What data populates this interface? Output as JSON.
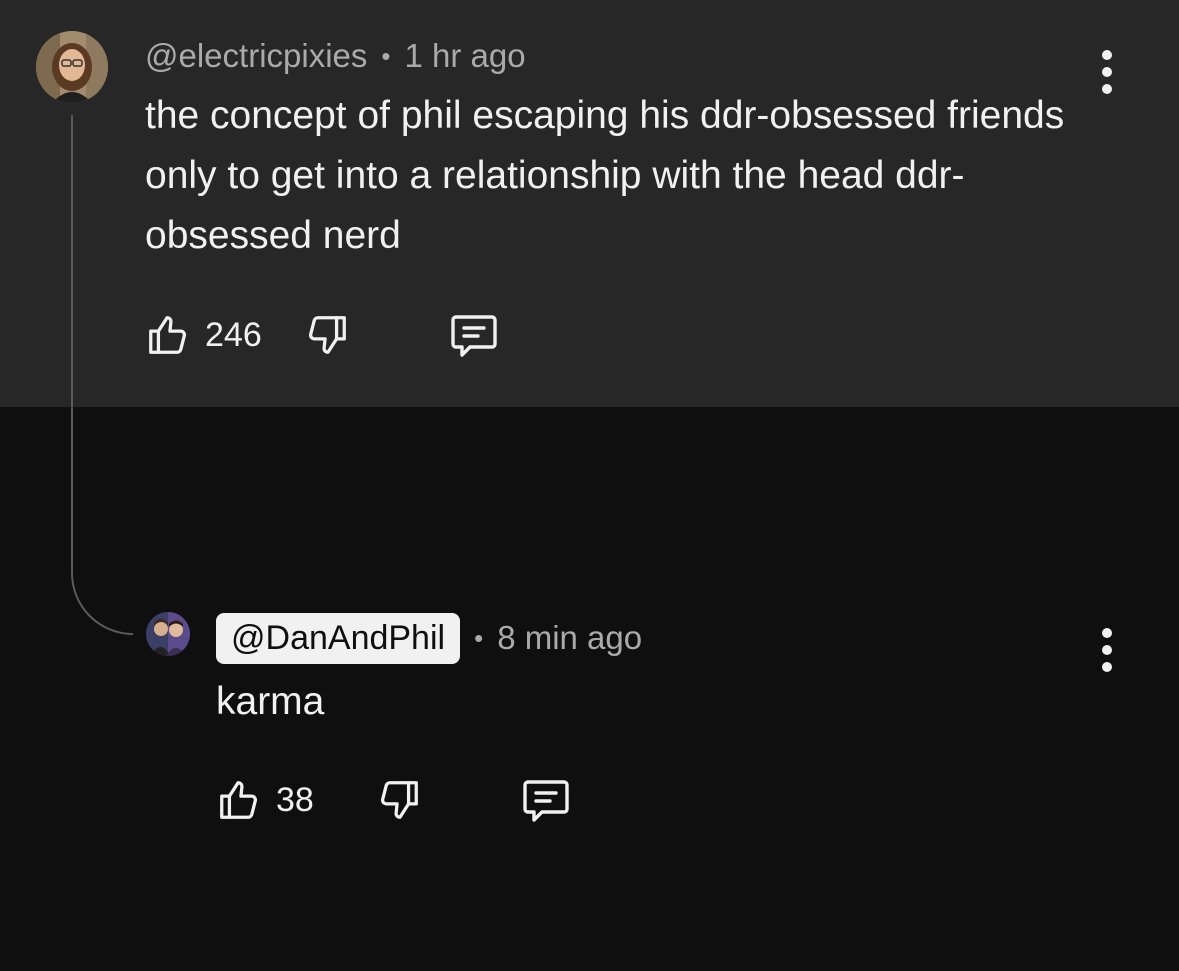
{
  "comment": {
    "handle": "@electricpixies",
    "separator": "•",
    "time": "1 hr ago",
    "text": "the concept of phil escaping his ddr-obsessed friends only to get into a relationship with the head ddr-obsessed nerd",
    "likes": "246",
    "icons": {
      "like": "thumbs-up-icon",
      "dislike": "thumbs-down-icon",
      "reply": "reply-icon",
      "menu": "more-vert-icon"
    }
  },
  "reply": {
    "handle": "@DanAndPhil",
    "separator": "•",
    "time": "8 min ago",
    "text": "karma",
    "likes": "38",
    "icons": {
      "like": "thumbs-up-icon",
      "dislike": "thumbs-down-icon",
      "reply": "reply-icon",
      "menu": "more-vert-icon"
    }
  },
  "colors": {
    "comment_bg": "#272727",
    "page_bg": "#0f0f0f",
    "text": "#f1f1f1",
    "meta_text": "#aaaaaa",
    "creator_badge_bg": "#f1f1f1"
  }
}
